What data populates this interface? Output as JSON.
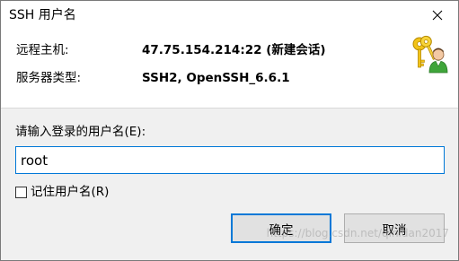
{
  "window": {
    "title": "SSH 用户名",
    "close_icon": "close-icon"
  },
  "info": {
    "host_label": "远程主机:",
    "host_value": "47.75.154.214:22 (新建会话)",
    "server_type_label": "服务器类型:",
    "server_type_value": "SSH2, OpenSSH_6.6.1",
    "icon": "keys-user-icon"
  },
  "form": {
    "prompt_label": "请输入登录的用户名(E):",
    "username_value": "root",
    "remember_label": "记住用户名(R)",
    "remember_checked": false
  },
  "buttons": {
    "ok_label": "确定",
    "cancel_label": "取消"
  },
  "watermark": "https://blog.csdn.net/qinidan2017",
  "colors": {
    "accent": "#0078d7",
    "panel_bg": "#f0f0f0"
  }
}
